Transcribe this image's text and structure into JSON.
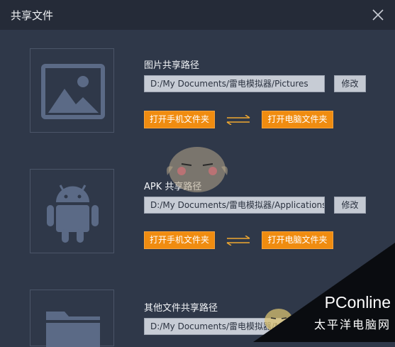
{
  "window": {
    "title": "共享文件",
    "close_icon": "close-icon"
  },
  "sections": [
    {
      "icon": "picture-icon",
      "title": "图片共享路径",
      "path": "D:/My Documents/雷电模拟器/Pictures",
      "modify_label": "修改",
      "open_phone_label": "打开手机文件夹",
      "open_pc_label": "打开电脑文件夹",
      "swap_icon": "swap-arrows-icon"
    },
    {
      "icon": "android-icon",
      "title": "APK 共享路径",
      "path": "D:/My Documents/雷电模拟器/Applications",
      "modify_label": "修改",
      "open_phone_label": "打开手机文件夹",
      "open_pc_label": "打开电脑文件夹",
      "swap_icon": "swap-arrows-icon"
    },
    {
      "icon": "folder-icon",
      "title": "其他文件共享路径",
      "path": "D:/My Documents/雷电模拟器/Misc"
    }
  ],
  "watermark": {
    "brand": "PConline",
    "tagline": "太平洋电脑网"
  },
  "colors": {
    "background": "#2f3849",
    "titlebar": "#252b38",
    "accent_orange": "#f08c10",
    "icon_fill": "#5b6a86"
  }
}
